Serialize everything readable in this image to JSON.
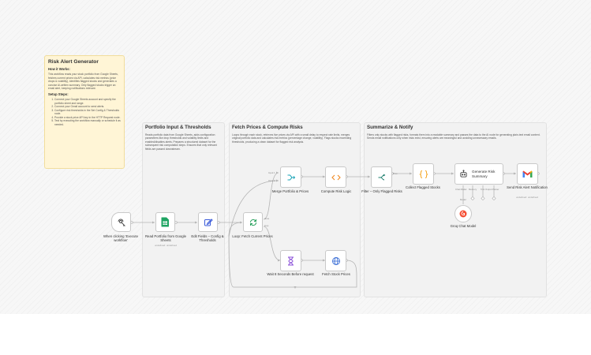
{
  "sticky_main": {
    "title": "Risk Alert Generator",
    "how_title": "How it Works:",
    "how_text": "This workflow reads your stock portfolio from Google Sheets, fetches current prices via API, calculates risk metrics (price drops & volatility), identifies flagged stocks and generates a concise AI-written summary. Only flagged stocks trigger an email alert, keeping notifications relevant.",
    "setup_title": "Setup Steps:",
    "steps": [
      "Connect your Google Sheets account and specify the portfolio sheet and range.",
      "Connect your Gmail account to send alerts.",
      "Configure risk thresholds in the Set Config & Thresholds node.",
      "Provide a stock price API key in the HTTP Request node.",
      "Test by executing the workflow manually or schedule it as needed."
    ]
  },
  "groups": {
    "portfolio": {
      "title": "Portfolio Input & Thresholds",
      "text": "Reads portfolio data from Google Sheets, adds configuration parameters like drop thresholds and volatility limits and enabled/disables alerts. Prepares a structured dataset for the subsequent risk computation steps. Ensures that only relevant fields are passed downstream."
    },
    "fetch": {
      "title": "Fetch Prices & Compute Risks",
      "text": "Loops through each stock, retrieves live prices via API with a small delay to respect rate limits, merges original portfolio data and calculates risk metrics (percentage change, volatility). Flags stocks exceeding thresholds, producing a clean dataset for flagged risk analysis."
    },
    "summarize": {
      "title": "Summarize & Notify",
      "text": "Filters only stocks with flagged risks, formats them into a readable summary and passes the data to the AI node for generating plain-text email content. Sends email notifications only when risks exist, ensuring alerts are meaningful and avoiding unnecessary emails."
    }
  },
  "nodes": {
    "trigger": {
      "label": "When clicking 'Execute workflow'"
    },
    "read_sheets": {
      "label": "Read Portfolio from Google Sheets",
      "note": "undefined: undefined"
    },
    "edit_fields": {
      "label": "Edit Fields – Config & Thresholds"
    },
    "loop": {
      "label": "Loop: Fetch Current Prices",
      "port_done": "done",
      "port_loop": "loop"
    },
    "merge": {
      "label": "Merge Portfolio & Prices",
      "port_in1": "Input 1",
      "port_in2": "Input 2"
    },
    "compute": {
      "label": "Compute Risk Logic"
    },
    "wait": {
      "label": "Wait 8 Seconds Before request"
    },
    "fetch_stock": {
      "label": "Fetch Stock Prices"
    },
    "filter": {
      "label": "Filter – Only Flagged Risks",
      "port_true": "True"
    },
    "collect": {
      "label": "Collect Flagged Stocks"
    },
    "generate": {
      "label": "Generate Risk Summary",
      "port_chat": "Chat Model",
      "port_memory": "Memory",
      "port_tool": "Tool",
      "port_parser": "Output Parser"
    },
    "gmail": {
      "label": "Send Risk Alert Notification",
      "note": "undefined: undefined"
    },
    "groq": {
      "label": "Groq Chat Model",
      "port_model": "Model"
    }
  },
  "colors": {
    "sheets": "#1fa463",
    "edit": "#3a5bd9",
    "loop": "#2aa25e",
    "merge": "#1ea5b8",
    "code": "#f08a24",
    "wait": "#8a4fd8",
    "http": "#3b6fd6",
    "filter": "#1e7f6e",
    "aggregate": "#f5a623",
    "gmail_red": "#ea4335",
    "groq": "#f55036",
    "edge": "#b4b4b4"
  },
  "icons": {
    "trigger": "pointer-click-icon",
    "read_sheets": "google-sheets-icon",
    "edit_fields": "pencil-icon",
    "loop": "loop-arrows-icon",
    "merge": "merge-icon",
    "compute": "code-icon",
    "wait": "hourglass-icon",
    "fetch_stock": "globe-icon",
    "filter": "filter-icon",
    "collect": "braces-icon",
    "generate": "robot-icon",
    "gmail": "gmail-icon",
    "groq": "groq-icon"
  }
}
